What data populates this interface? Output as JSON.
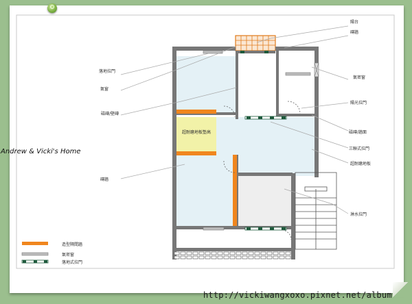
{
  "signature": "Andrew & Vicki's Home",
  "url": "http://vickiwangxoxo.pixnet.net/album",
  "room_labels": {
    "center_room": "超耐磨地板墊高"
  },
  "callouts": {
    "right": [
      {
        "text": "陽台"
      },
      {
        "text": "磚牆"
      },
      {
        "text": "氣密窗"
      },
      {
        "text": "陽光拉門"
      },
      {
        "text": "磁磚/牆面"
      },
      {
        "text": "三聯式拉門"
      },
      {
        "text": "超耐磨地板"
      },
      {
        "text": "淋水拉門"
      }
    ],
    "left": [
      {
        "text": "落地拉門"
      },
      {
        "text": "氣窗"
      },
      {
        "text": "磁磚/壁磚"
      },
      {
        "text": "磚牆"
      }
    ]
  },
  "legend": [
    {
      "text": "造型隔間牆",
      "swatch": "orange-wall",
      "color": "#f0861e"
    },
    {
      "text": "氣密窗",
      "swatch": "gray-window",
      "color": "#9a9a9a"
    },
    {
      "text": "落地式拉門",
      "swatch": "sliding-door",
      "color": "#1e5a3c"
    }
  ],
  "colors": {
    "background": "#9bbf8e",
    "wall": "#777777",
    "orange_wall": "#f0861e",
    "raised_floor": "#f2f2a8",
    "light_blue_floor": "#e4f1f6",
    "gray_floor": "#eeeeee",
    "callout_line": "#aaaaaa",
    "door_green": "#1e5a3c"
  }
}
